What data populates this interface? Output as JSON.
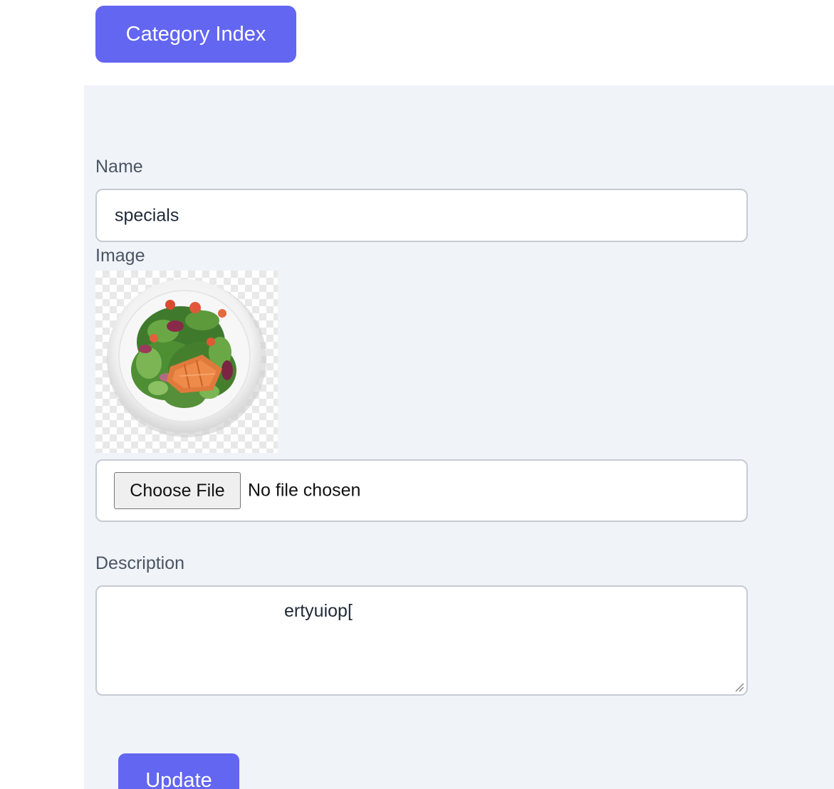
{
  "header": {
    "index_button_label": "Category Index"
  },
  "form": {
    "name_label": "Name",
    "name_value": "specials",
    "image_label": "Image",
    "file_button_label": "Choose File",
    "file_status": "No file chosen",
    "description_label": "Description",
    "description_value": "ertyuiop[",
    "submit_label": "Update"
  },
  "colors": {
    "accent": "#6366f1",
    "panel_background": "#f0f3f8"
  },
  "icons": [
    "salad-plate-image",
    "resize-grip-icon"
  ]
}
